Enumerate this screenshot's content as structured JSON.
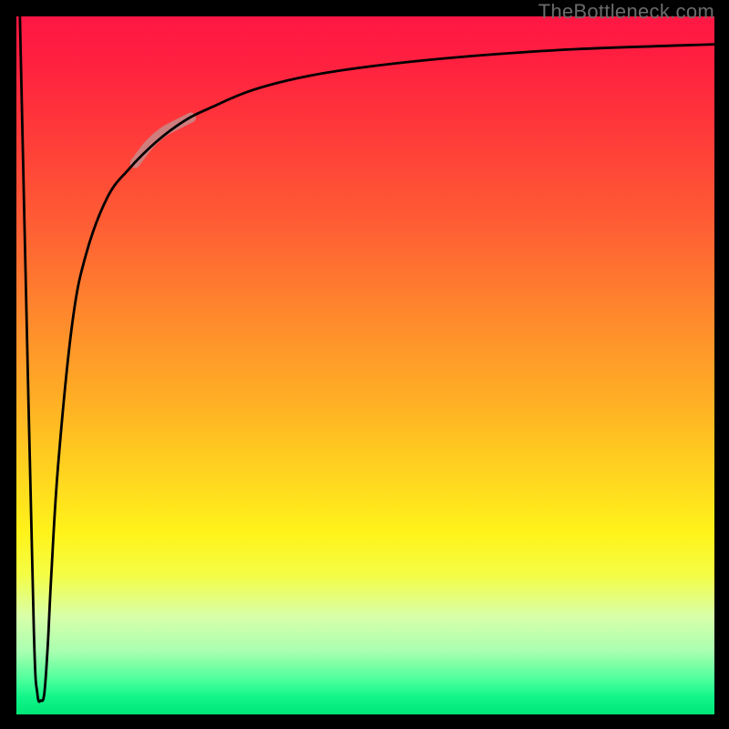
{
  "watermark": "TheBottleneck.com",
  "chart_data": {
    "type": "line",
    "title": "",
    "xlabel": "",
    "ylabel": "",
    "xlim": [
      0,
      100
    ],
    "ylim": [
      0,
      100
    ],
    "grid": false,
    "series": [
      {
        "name": "bottleneck-curve",
        "color": "#000000",
        "x": [
          0.5,
          1.5,
          2.5,
          3.0,
          3.5,
          4.0,
          4.5,
          5.0,
          6.0,
          8.0,
          10.0,
          13.0,
          16.0,
          20.0,
          24.0,
          28.0,
          34.0,
          42.0,
          52.0,
          65.0,
          80.0,
          100.0
        ],
        "values": [
          100,
          55,
          12,
          3,
          2,
          3,
          10,
          20,
          36,
          56,
          66,
          74,
          78,
          82,
          85,
          87,
          89.5,
          91.5,
          93,
          94.3,
          95.3,
          96
        ]
      },
      {
        "name": "highlight-segment",
        "color": "#c78a8a",
        "x": [
          17.0,
          19.0,
          21.0,
          23.0,
          25.0
        ],
        "values": [
          79.0,
          81.6,
          83.4,
          84.5,
          85.5
        ]
      }
    ],
    "gradient_stops": [
      {
        "pos": 0,
        "color": "#ff1744"
      },
      {
        "pos": 0.5,
        "color": "#ffb224"
      },
      {
        "pos": 0.75,
        "color": "#fff31a"
      },
      {
        "pos": 1.0,
        "color": "#00e676"
      }
    ]
  }
}
